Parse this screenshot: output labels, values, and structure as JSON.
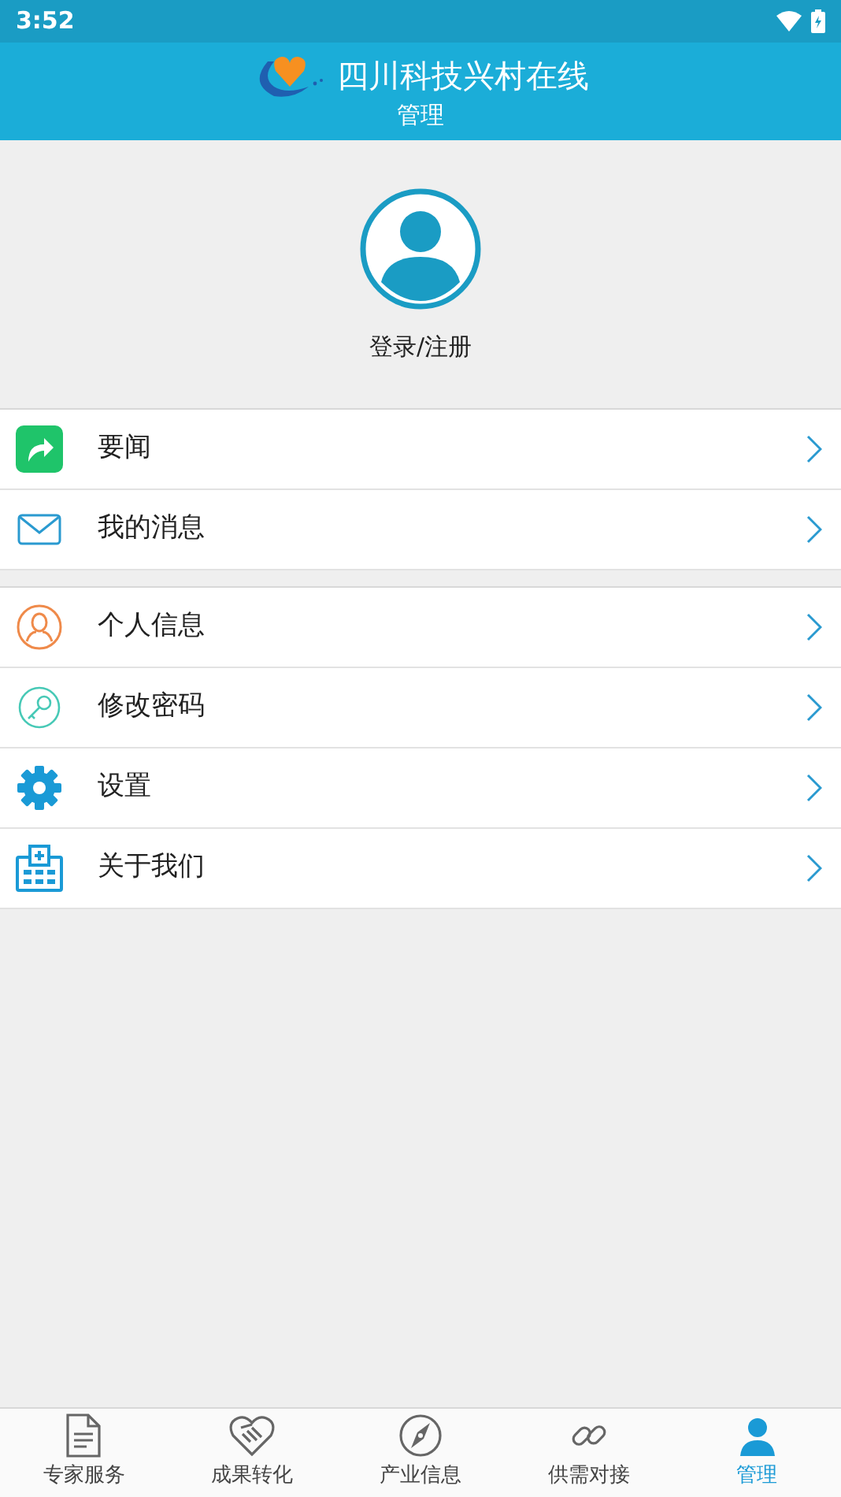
{
  "status_bar": {
    "time": "3:52"
  },
  "header": {
    "title": "四川科技兴村在线",
    "subtitle": "管理"
  },
  "profile": {
    "login_label": "登录/注册"
  },
  "menu_groups": [
    [
      {
        "kind": "share",
        "label": "要闻"
      },
      {
        "kind": "mail",
        "label": "我的消息"
      }
    ],
    [
      {
        "kind": "person",
        "label": "个人信息"
      },
      {
        "kind": "key",
        "label": "修改密码"
      },
      {
        "kind": "gear",
        "label": "设置"
      },
      {
        "kind": "building",
        "label": "关于我们"
      }
    ]
  ],
  "tab_bar": [
    {
      "kind": "document",
      "label": "专家服务",
      "selected": false
    },
    {
      "kind": "handshake",
      "label": "成果转化",
      "selected": false
    },
    {
      "kind": "compass",
      "label": "产业信息",
      "selected": false
    },
    {
      "kind": "link",
      "label": "供需对接",
      "selected": false
    },
    {
      "kind": "person",
      "label": "管理",
      "selected": true
    }
  ]
}
